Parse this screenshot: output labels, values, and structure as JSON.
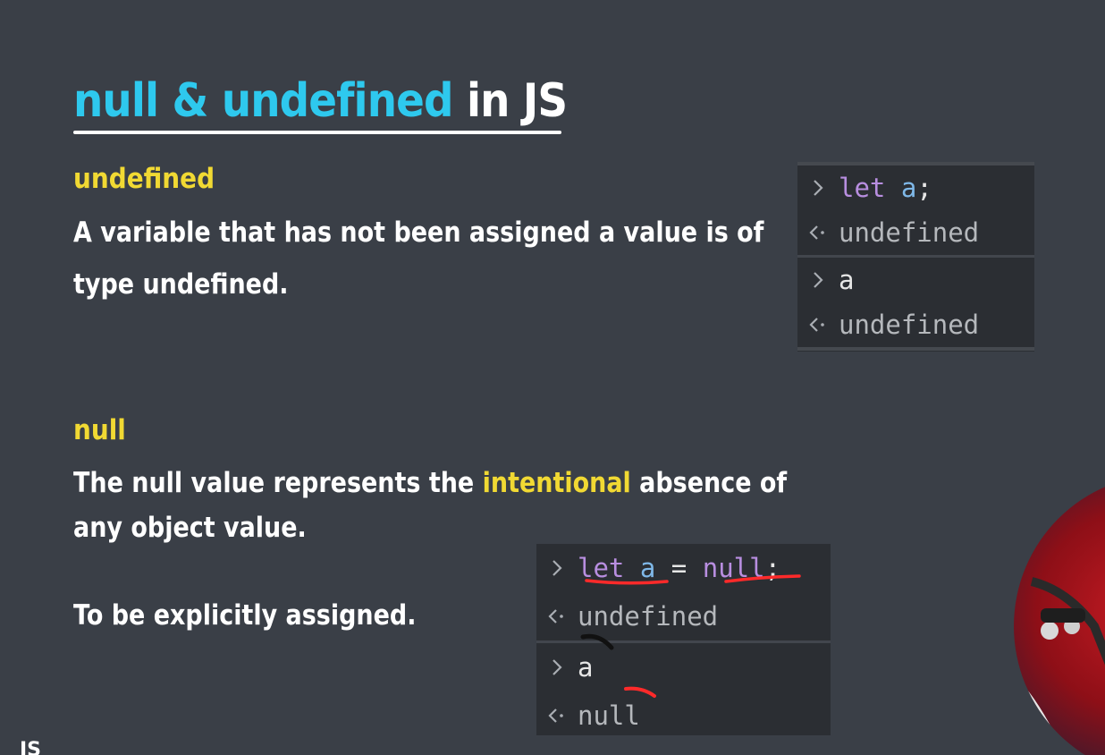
{
  "slide": {
    "title_highlight": "null & undefined",
    "title_rest": "in JS",
    "footer_label": "JS"
  },
  "section_undefined": {
    "heading": "undefined",
    "line1": "A variable that has not been assigned a value is of",
    "line2": "type undefined."
  },
  "section_null": {
    "heading": "null",
    "line1_before": "The null value represents the ",
    "line1_highlight": "intentional",
    "line1_after": " absence of",
    "line2": "any object value.",
    "line3": "To be explicitly assigned."
  },
  "console_1": {
    "row1": {
      "kw": "let",
      "var": "a",
      "punct": ";"
    },
    "row2": {
      "output": "undefined"
    },
    "row3": {
      "input": "a"
    },
    "row4": {
      "output": "undefined"
    }
  },
  "console_2": {
    "row1": {
      "kw": "let",
      "var": "a",
      "op": "=",
      "value": "null",
      "punct": ";"
    },
    "row2": {
      "output": "undefined"
    },
    "row3": {
      "input": "a"
    },
    "row4": {
      "output": "null"
    }
  },
  "colors": {
    "background": "#3a3f47",
    "title_accent": "#2ec9ee",
    "heading_yellow": "#f1d933",
    "console_bg": "#2b2e33",
    "keyword": "#b88ee0",
    "variable": "#7fb8e8",
    "annotation_red": "#ff2a2a"
  }
}
